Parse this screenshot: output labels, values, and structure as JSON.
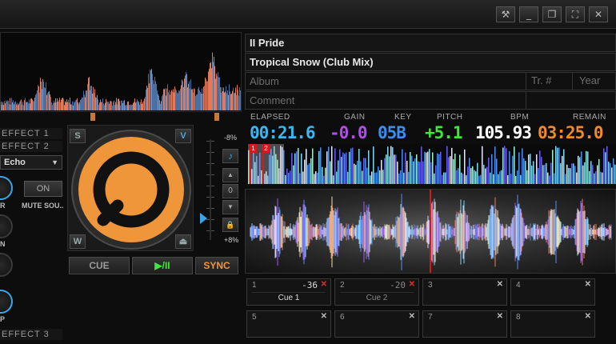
{
  "window": {
    "buttons": [
      {
        "name": "tools-icon",
        "glyph": "⚒"
      },
      {
        "name": "minimize-icon",
        "glyph": "_"
      },
      {
        "name": "restore-icon",
        "glyph": "❐"
      },
      {
        "name": "fullscreen-icon",
        "glyph": "⛶"
      },
      {
        "name": "close-icon",
        "glyph": "✕"
      }
    ]
  },
  "effects": {
    "slot1": "EFFECT 1",
    "slot2": "EFFECT 2",
    "selected": "Echo",
    "on_label": "ON",
    "mute_label": "MUTE SOU...",
    "slot3": "EFFECT 3",
    "knob_labels": [
      "R",
      "N",
      "",
      "P"
    ]
  },
  "platter": {
    "s_label": "S",
    "v_label": "V",
    "w_label": "W",
    "eject_glyph": "⏏",
    "accent": "#f0963a"
  },
  "pitch": {
    "min_label": "-8%",
    "max_label": "+8%",
    "note_glyph": "♪",
    "zero_label": "0",
    "lock_glyph": "🔒"
  },
  "transport": {
    "cue_label": "CUE",
    "play_label": "▶/II",
    "sync_label": "SYNC"
  },
  "track": {
    "artist": "II Pride",
    "title": "Tropical Snow (Club Mix)",
    "album_placeholder": "Album",
    "track_no_placeholder": "Tr. #",
    "year_placeholder": "Year",
    "comment_placeholder": "Comment"
  },
  "readouts": {
    "elapsed_label": "ELAPSED",
    "elapsed": "00:21.6",
    "gain_label": "GAIN",
    "gain": "-0.0",
    "key_label": "KEY",
    "key": "05B",
    "pitch_label": "PITCH",
    "pitch": "+5.1",
    "bpm_label": "BPM",
    "bpm": "105.93",
    "remain_label": "REMAIN",
    "remain": "03:25.0"
  },
  "colors": {
    "elapsed": "#3ab6f0",
    "gain": "#b04ee8",
    "key": "#3a8ef0",
    "pitch": "#3ee83a",
    "bpm": "#ffffff",
    "remain": "#f08a2a",
    "cue_marker": "#d41a1a"
  },
  "cue_markers": [
    "1",
    "2"
  ],
  "cues": [
    {
      "num": "1",
      "value": "-36",
      "name": "Cue 1",
      "set": true
    },
    {
      "num": "2",
      "value": "-20",
      "name": "Cue 2",
      "set": true
    },
    {
      "num": "3",
      "value": "",
      "name": "",
      "set": false
    },
    {
      "num": "4",
      "value": "",
      "name": "",
      "set": false
    },
    {
      "num": "5",
      "value": "",
      "name": "",
      "set": false
    },
    {
      "num": "6",
      "value": "",
      "name": "",
      "set": false
    },
    {
      "num": "7",
      "value": "",
      "name": "",
      "set": false
    },
    {
      "num": "8",
      "value": "",
      "name": "",
      "set": false
    }
  ],
  "close_glyph": "✕"
}
